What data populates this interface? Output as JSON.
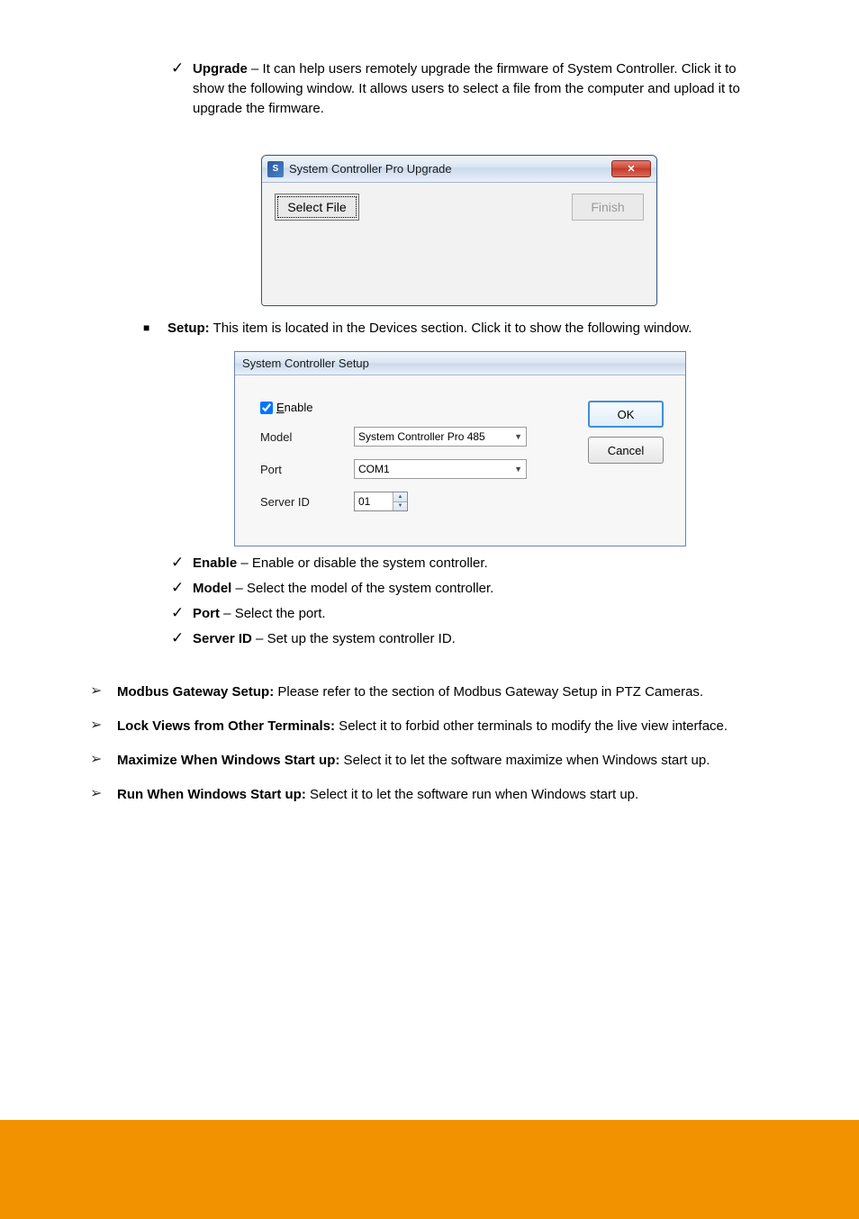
{
  "upgrade_intro": {
    "term": "Upgrade",
    "dash": " – ",
    "text": "It can help users remotely upgrade the firmware of System Controller. Click it to show the following window. It allows users to select a file from the computer and upload it to upgrade the firmware."
  },
  "win_upgrade": {
    "title": "System Controller Pro Upgrade",
    "select_file": "Select File",
    "finish": "Finish",
    "close_glyph": "✕"
  },
  "setup_intro": {
    "term": "Setup:",
    "text": " This item is located in the Devices section. Click it to show the following window."
  },
  "win_setup": {
    "title": "System Controller Setup",
    "enable_prefix": "E",
    "enable_rest": "nable",
    "label_model": "Model",
    "label_port": "Port",
    "label_serverid": "Server ID",
    "model_value": "System Controller Pro 485",
    "port_value": "COM1",
    "serverid_value": "01",
    "ok": "OK",
    "cancel": "Cancel"
  },
  "checks": {
    "enable": {
      "term": "Enable",
      "dash": " – ",
      "text": "Enable or disable the system controller."
    },
    "model": {
      "term": "Model",
      "dash": " – ",
      "text": "Select the model of the system controller."
    },
    "port": {
      "term": "Port",
      "dash": " – ",
      "text": "Select the port."
    },
    "serverid": {
      "term": "Server ID",
      "dash": " – ",
      "text": "Set up the system controller ID."
    }
  },
  "arrows": {
    "modbus": {
      "term": "Modbus Gateway Setup:",
      "text": " Please refer to the section of Modbus Gateway Setup in PTZ Cameras."
    },
    "lockview": {
      "term": "Lock Views from Other Terminals:",
      "text": " Select it to forbid other terminals to modify the live view interface."
    },
    "maximize": {
      "term": "Maximize When Windows Start up:",
      "text": " Select it to let the software maximize when Windows start up."
    },
    "run": {
      "term": "Run When Windows Start up:",
      "text": " Select it to let the software run when Windows start up."
    }
  }
}
